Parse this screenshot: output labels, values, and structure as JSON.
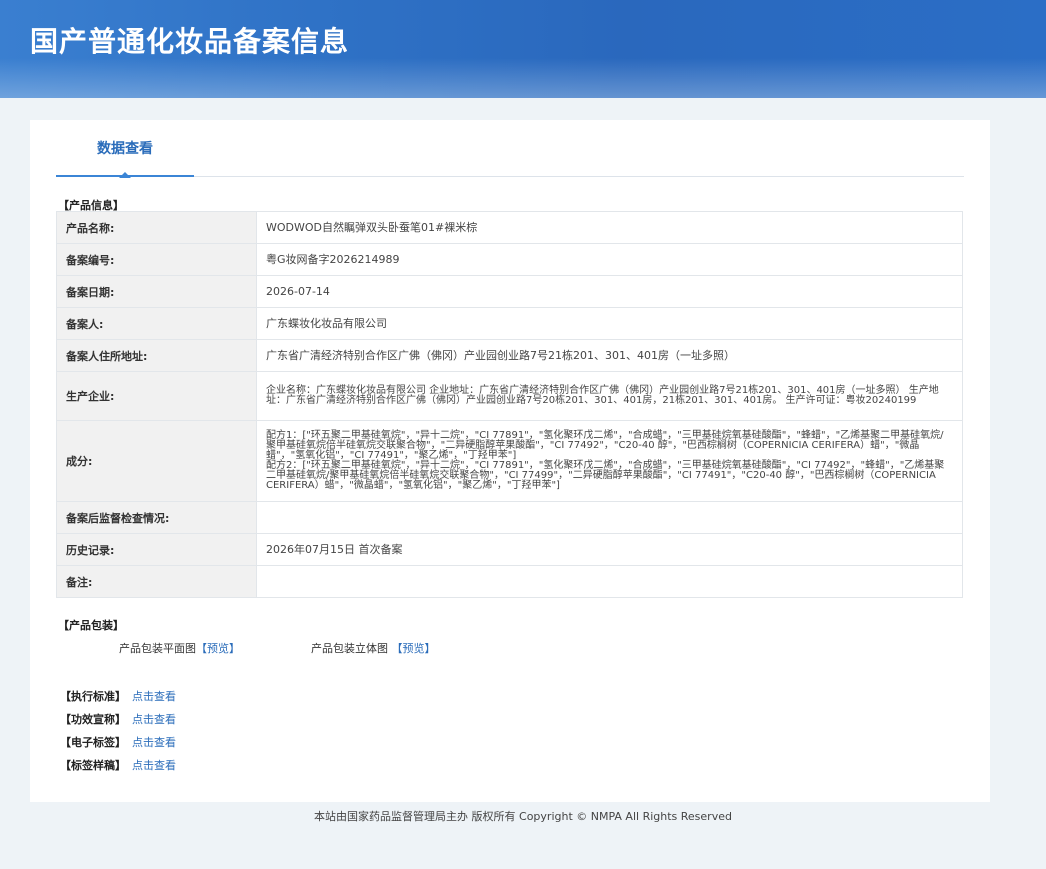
{
  "header": {
    "title": "国产普通化妆品备案信息"
  },
  "tab": {
    "label": "数据查看"
  },
  "product_info": {
    "section_title": "【产品信息】",
    "rows": [
      {
        "label": "产品名称:",
        "value": "WODWOD自然瞩弹双头卧蚕笔01#裸米棕"
      },
      {
        "label": "备案编号:",
        "value": "粤G妆网备字2026214989"
      },
      {
        "label": "备案日期:",
        "value": "2026-07-14"
      },
      {
        "label": "备案人:",
        "value": "广东蝶妆化妆品有限公司"
      },
      {
        "label": "备案人住所地址:",
        "value": "广东省广清经济特别合作区广佛（佛冈）产业园创业路7号21栋201、301、401房（一址多照）"
      },
      {
        "label": "生产企业:",
        "value": "企业名称：广东蝶妆化妆品有限公司 企业地址：广东省广清经济特别合作区广佛（佛冈）产业园创业路7号21栋201、301、401房（一址多照） 生产地址：广东省广清经济特别合作区广佛（佛冈）产业园创业路7号20栋201、301、401房，21栋201、301、401房。 生产许可证：粤妆20240199"
      },
      {
        "label": "成分:",
        "value": "配方1：[\"环五聚二甲基硅氧烷\"，\"异十二烷\"，\"CI 77891\"，\"氢化聚环戊二烯\"，\"合成蜡\"，\"三甲基硅烷氧基硅酸酯\"，\"蜂蜡\"，\"乙烯基聚二甲基硅氧烷/聚甲基硅氧烷倍半硅氧烷交联聚合物\"，\"二异硬脂醇苹果酸酯\"，\"CI 77492\"，\"C20-40 醇\"，\"巴西棕榈树（COPERNICIA CERIFERA）蜡\"，\"微晶蜡\"，\"氢氧化铝\"，\"CI 77491\"，\"聚乙烯\"，\"丁羟甲苯\"]\n配方2：[\"环五聚二甲基硅氧烷\"，\"异十二烷\"，\"CI 77891\"，\"氢化聚环戊二烯\"，\"合成蜡\"，\"三甲基硅烷氧基硅酸酯\"，\"CI 77492\"，\"蜂蜡\"，\"乙烯基聚二甲基硅氧烷/聚甲基硅氧烷倍半硅氧烷交联聚合物\"，\"CI 77499\"，\"二异硬脂醇苹果酸酯\"，\"CI 77491\"，\"C20-40 醇\"，\"巴西棕榈树（COPERNICIA CERIFERA）蜡\"，\"微晶蜡\"，\"氢氧化铝\"，\"聚乙烯\"，\"丁羟甲苯\"]"
      },
      {
        "label": "备案后监督检查情况:",
        "value": ""
      },
      {
        "label": "历史记录:",
        "value": "2026年07月15日 首次备案"
      },
      {
        "label": "备注:",
        "value": ""
      }
    ]
  },
  "packaging": {
    "section_title": "【产品包装】",
    "flat_label": "产品包装平面图",
    "flat_link": "【预览】",
    "solid_label": "产品包装立体图",
    "solid_link": "【预览】"
  },
  "standards": [
    {
      "key": "【执行标准】",
      "link": "点击查看"
    },
    {
      "key": "【功效宣称】",
      "link": "点击查看"
    },
    {
      "key": "【电子标签】",
      "link": "点击查看"
    },
    {
      "key": "【标签样稿】",
      "link": "点击查看"
    }
  ],
  "footer": {
    "text": "本站由国家药品监督管理局主办 版权所有 Copyright © NMPA All Rights Reserved"
  }
}
